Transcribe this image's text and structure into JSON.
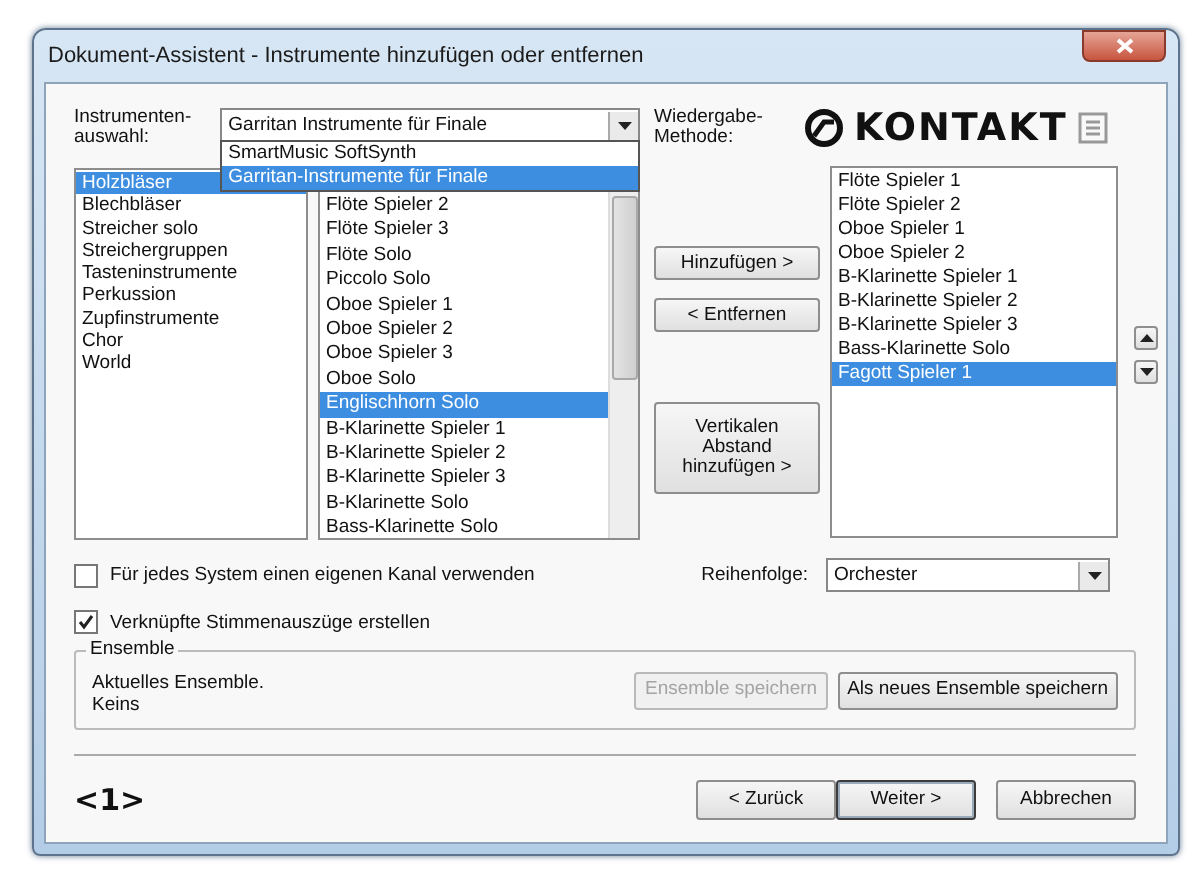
{
  "window": {
    "title": "Dokument-Assistent - Instrumente hinzufügen oder entfernen"
  },
  "source": {
    "label": "Instrumenten-\nauswahl:",
    "value": "Garritan Instrumente für Finale",
    "expanded": true,
    "options": [
      {
        "label": "SmartMusic SoftSynth",
        "selected": false
      },
      {
        "label": "Garritan-Instrumente für Finale",
        "selected": true
      }
    ]
  },
  "categories": [
    {
      "label": "Holzbläser",
      "selected": true
    },
    {
      "label": "Blechbläser",
      "selected": false
    },
    {
      "label": "Streicher solo",
      "selected": false
    },
    {
      "label": "Streichergruppen",
      "selected": false
    },
    {
      "label": "Tasteninstrumente",
      "selected": false
    },
    {
      "label": "Perkussion",
      "selected": false
    },
    {
      "label": "Zupfinstrumente",
      "selected": false
    },
    {
      "label": "Chor",
      "selected": false
    },
    {
      "label": "World",
      "selected": false
    }
  ],
  "instruments": [
    {
      "label": "Flöte Spieler 2",
      "selected": false
    },
    {
      "label": "Flöte Spieler 3",
      "selected": false
    },
    {
      "label": "Flöte Solo",
      "selected": false
    },
    {
      "label": "Piccolo Solo",
      "selected": false
    },
    {
      "label": "Oboe Spieler 1",
      "selected": false
    },
    {
      "label": "Oboe Spieler 2",
      "selected": false
    },
    {
      "label": "Oboe Spieler 3",
      "selected": false
    },
    {
      "label": "Oboe Solo",
      "selected": false
    },
    {
      "label": "Englischhorn Solo",
      "selected": true
    },
    {
      "label": "B-Klarinette Spieler 1",
      "selected": false
    },
    {
      "label": "B-Klarinette Spieler 2",
      "selected": false
    },
    {
      "label": "B-Klarinette Spieler 3",
      "selected": false
    },
    {
      "label": "B-Klarinette Solo",
      "selected": false
    },
    {
      "label": "Bass-Klarinette Solo",
      "selected": false
    }
  ],
  "playback": {
    "label": "Wiedergabe-\nMethode:",
    "logo": "KONTAKT"
  },
  "actions": [
    {
      "label": "Hinzufügen >"
    },
    {
      "label": "< Entfernen"
    },
    {
      "label": "Vertikalen\nAbstand\nhinzufügen >"
    }
  ],
  "score": [
    {
      "label": "Flöte Spieler 1",
      "selected": false
    },
    {
      "label": "Flöte Spieler 2",
      "selected": false
    },
    {
      "label": "Oboe Spieler 1",
      "selected": false
    },
    {
      "label": "Oboe Spieler 2",
      "selected": false
    },
    {
      "label": "B-Klarinette Spieler 1",
      "selected": false
    },
    {
      "label": "B-Klarinette Spieler 2",
      "selected": false
    },
    {
      "label": "B-Klarinette Spieler 3",
      "selected": false
    },
    {
      "label": "Bass-Klarinette Solo",
      "selected": false
    },
    {
      "label": "Fagott Spieler 1",
      "selected": true
    }
  ],
  "options": [
    {
      "label": "Für jedes System einen eigenen Kanal verwenden",
      "checked": false
    },
    {
      "label": "Verknüpfte Stimmenauszüge erstellen",
      "checked": true
    }
  ],
  "order": {
    "label": "Reihenfolge:",
    "value": "Orchester"
  },
  "ensemble": {
    "title": "Ensemble",
    "current_label": "Aktuelles Ensemble.",
    "current_value": "Keins",
    "buttons": [
      {
        "label": "Ensemble speichern",
        "disabled": true
      },
      {
        "label": "Als neues Ensemble speichern",
        "disabled": false
      }
    ]
  },
  "step": "<1>",
  "nav": [
    {
      "label": "< Zurück",
      "default": false
    },
    {
      "label": "Weiter >",
      "default": true
    },
    {
      "label": "Abbrechen",
      "default": false
    }
  ]
}
